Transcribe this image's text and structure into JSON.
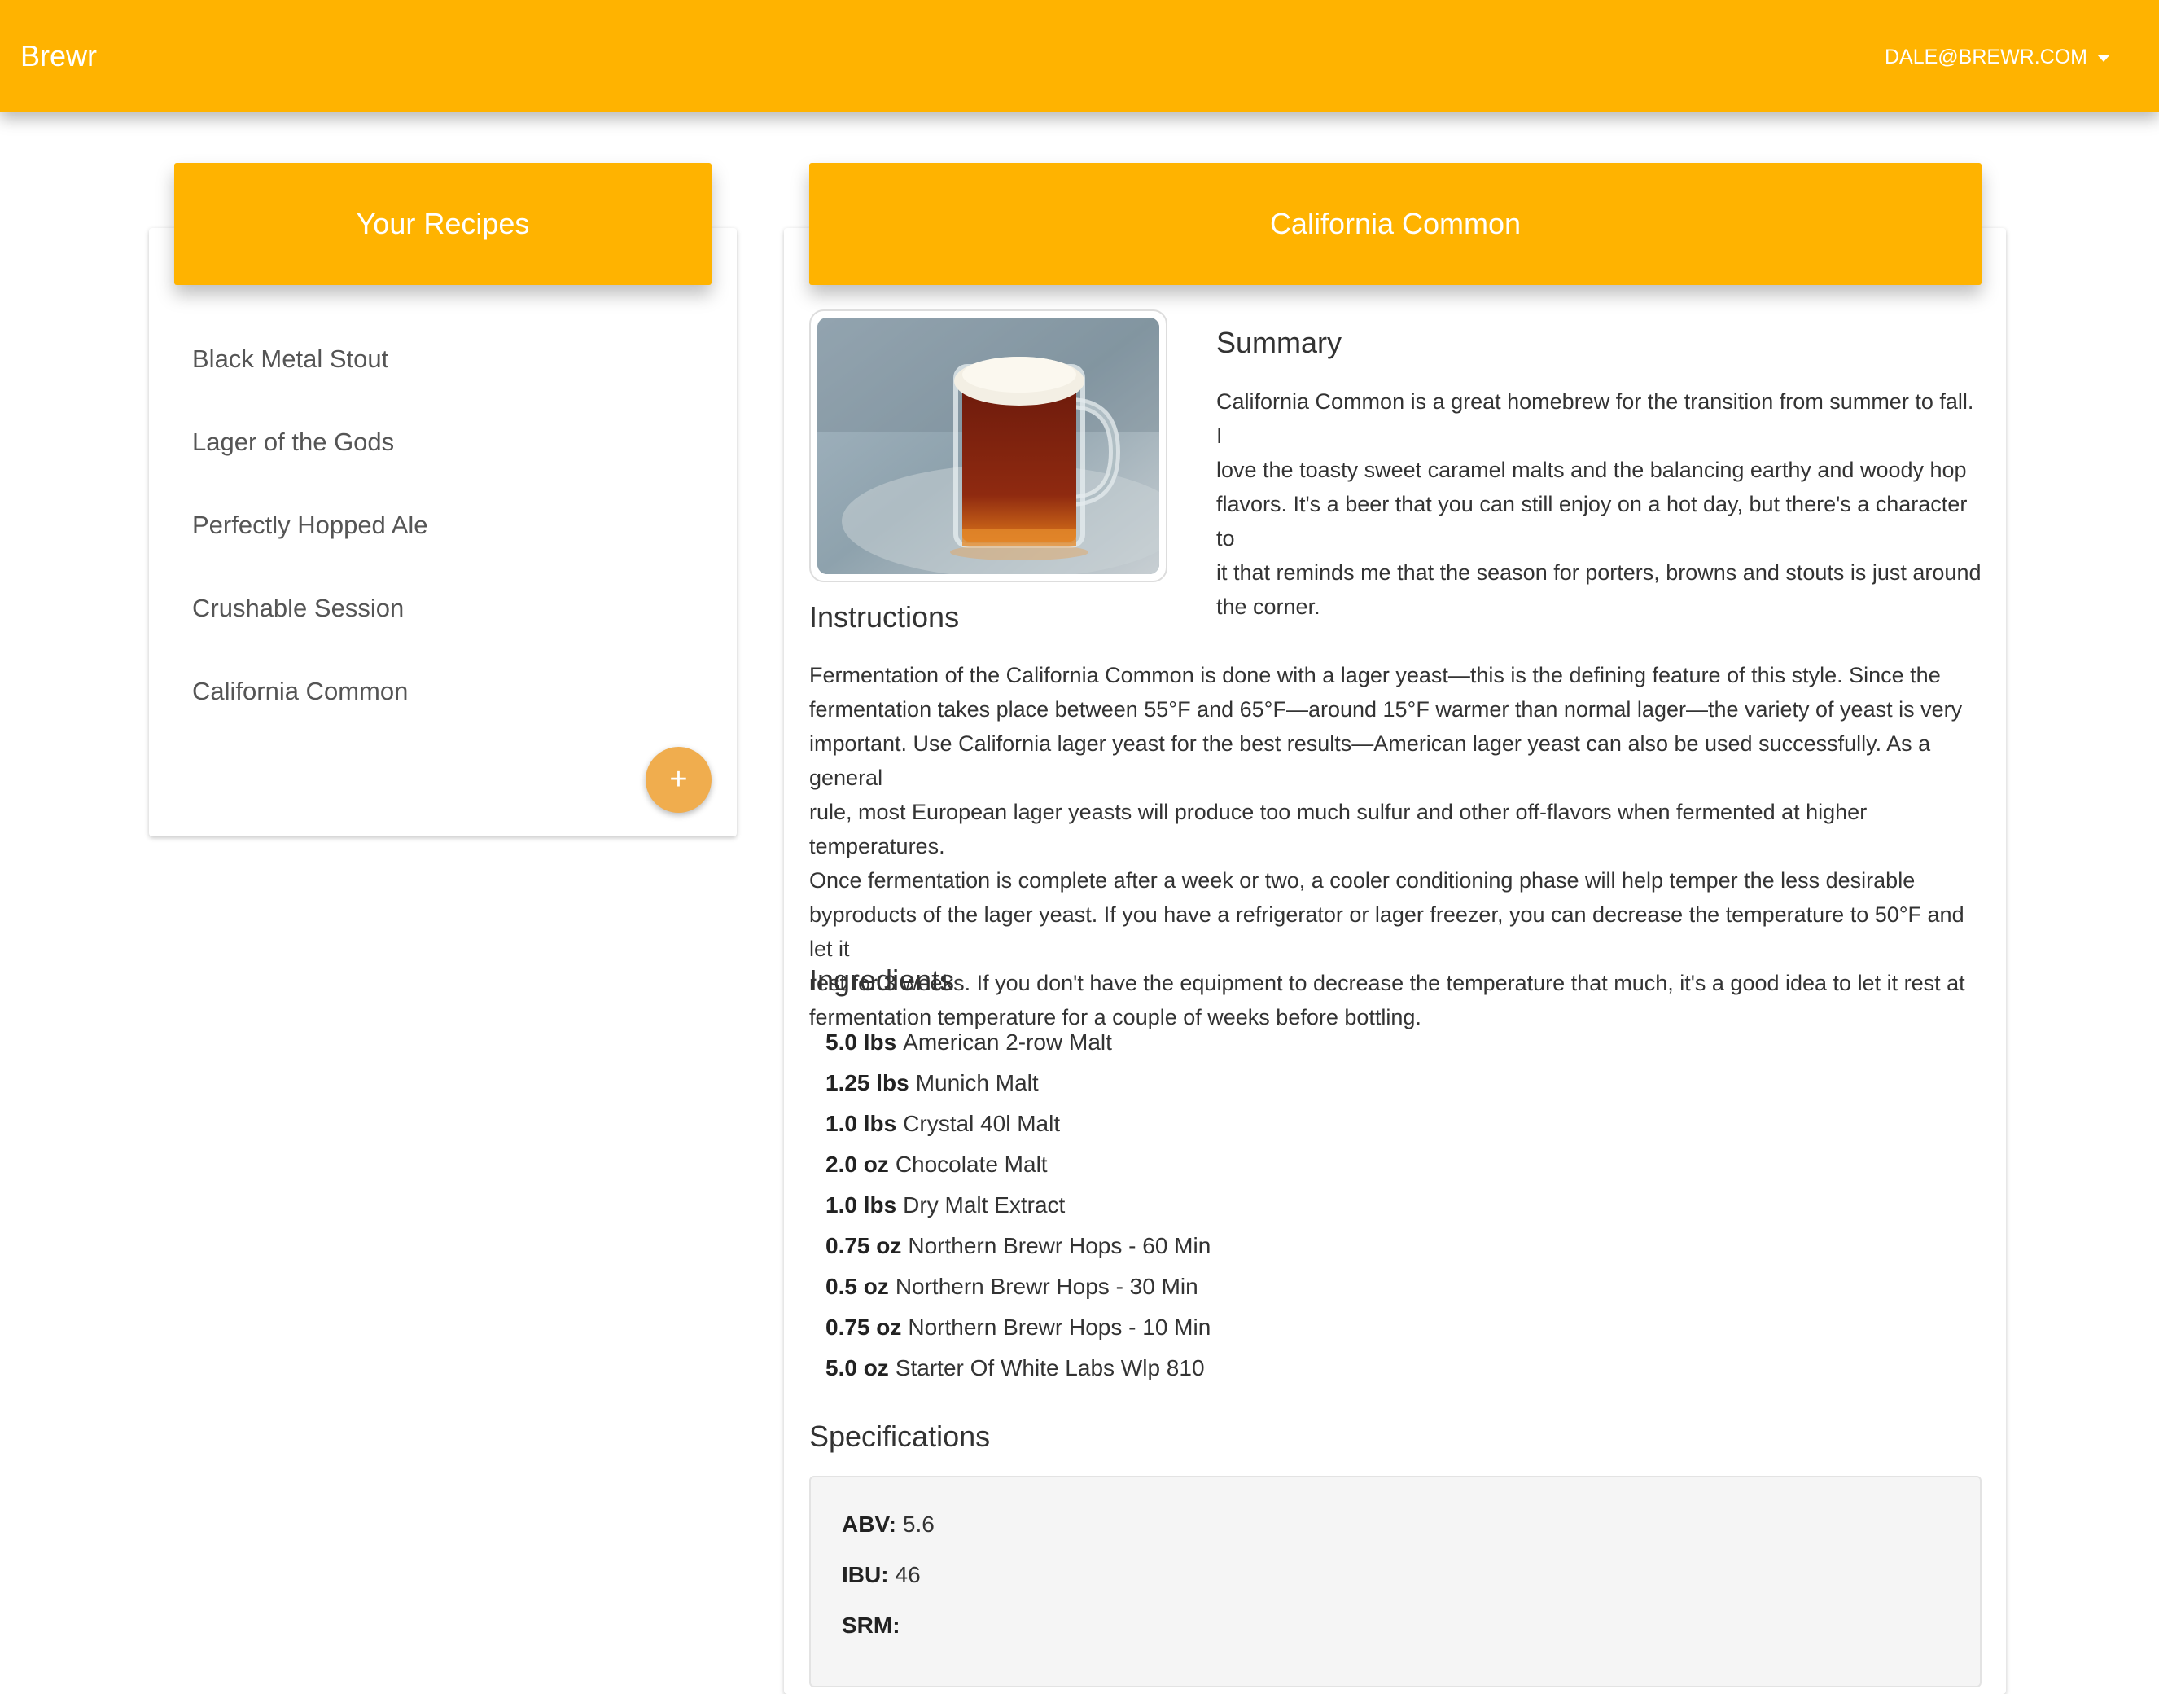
{
  "navbar": {
    "brand": "Brewr",
    "user_email": "DALE@BREWR.COM",
    "bg_color": "#ffb300"
  },
  "sidebar": {
    "title": "Your Recipes",
    "recipes": [
      {
        "label": "Black Metal Stout"
      },
      {
        "label": "Lager of the Gods"
      },
      {
        "label": "Perfectly Hopped Ale"
      },
      {
        "label": "Crushable Session"
      },
      {
        "label": "California Common"
      }
    ],
    "add_button_icon": "plus-icon",
    "add_button_label": "+"
  },
  "recipe": {
    "title": "California Common",
    "summary_heading": "Summary",
    "summary_lines": [
      "California Common is a great homebrew for the transition from summer to fall. I",
      "love the toasty sweet caramel malts and the balancing earthy and woody hop",
      "flavors. It's a beer that you can still enjoy on a hot day, but there's a character to",
      "it that reminds me that the season for porters, browns and stouts is just around",
      "the corner."
    ],
    "instructions_heading": "Instructions",
    "instructions_lines": [
      "Fermentation of the California Common is done with a lager yeast—this is the defining feature of this style. Since the",
      "fermentation takes place between 55°F and 65°F—around 15°F warmer than normal lager—the variety of yeast is very",
      "important. Use California lager yeast for the best results—American lager yeast can also be used successfully. As a general",
      "rule, most European lager yeasts will produce too much sulfur and other off-flavors when fermented at higher temperatures.",
      "Once fermentation is complete after a week or two, a cooler conditioning phase will help temper the less desirable",
      "byproducts of the lager yeast. If you have a refrigerator or lager freezer, you can decrease the temperature to 50°F and let it",
      "rest for 3 weeks. If you don't have the equipment to decrease the temperature that much, it's a good idea to let it rest at",
      "fermentation temperature for a couple of weeks before bottling."
    ],
    "ingredients_heading": "Ingredients",
    "ingredients": [
      {
        "amount": "5.0 lbs",
        "name": "American 2-row Malt"
      },
      {
        "amount": "1.25 lbs",
        "name": "Munich Malt"
      },
      {
        "amount": "1.0 lbs",
        "name": "Crystal 40l Malt"
      },
      {
        "amount": "2.0 oz",
        "name": "Chocolate Malt"
      },
      {
        "amount": "1.0 lbs",
        "name": "Dry Malt Extract"
      },
      {
        "amount": "0.75 oz",
        "name": "Northern Brewr Hops - 60 Min"
      },
      {
        "amount": "0.5 oz",
        "name": "Northern Brewr Hops - 30 Min"
      },
      {
        "amount": "0.75 oz",
        "name": "Northern Brewr Hops - 10 Min"
      },
      {
        "amount": "5.0 oz",
        "name": "Starter Of White Labs Wlp 810"
      }
    ],
    "specifications_heading": "Specifications",
    "specs": {
      "abv_label": "ABV:",
      "abv_value": "5.6",
      "ibu_label": "IBU:",
      "ibu_value": "46",
      "srm_label": "SRM:",
      "srm_value": ""
    }
  }
}
